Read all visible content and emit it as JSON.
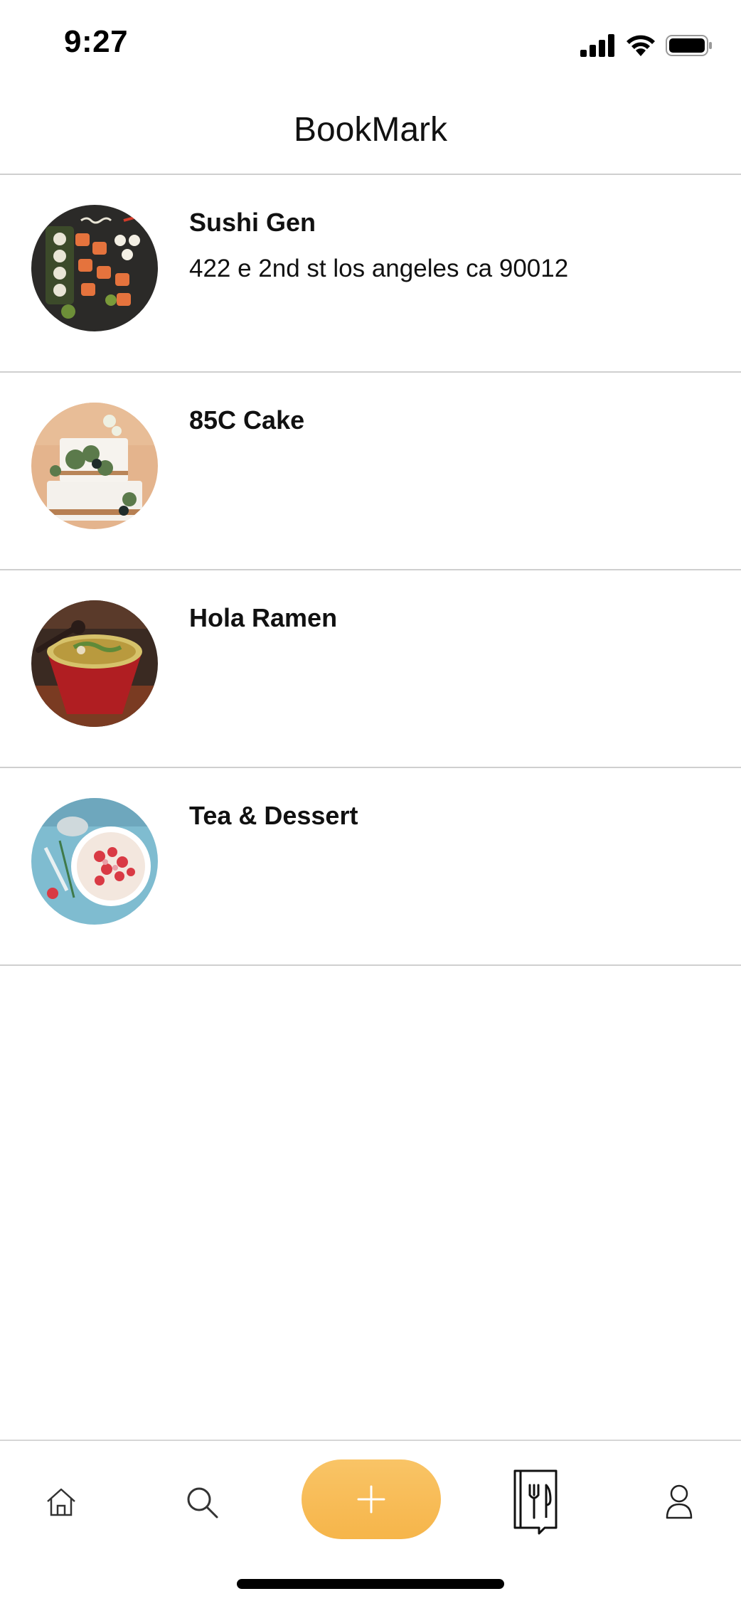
{
  "status_bar": {
    "time": "9:27",
    "icons": [
      "signal-icon",
      "wifi-icon",
      "battery-icon"
    ]
  },
  "header": {
    "title": "BookMark"
  },
  "bookmarks": [
    {
      "name": "Sushi Gen",
      "address": "422 e 2nd st los angeles ca 90012",
      "image": "sushi-photo"
    },
    {
      "name": "85C Cake",
      "address": "",
      "image": "cake-photo"
    },
    {
      "name": "Hola Ramen",
      "address": "",
      "image": "ramen-photo"
    },
    {
      "name": "Tea & Dessert",
      "address": "",
      "image": "dessert-photo"
    }
  ],
  "tab_bar": {
    "items": [
      "home-icon",
      "search-icon",
      "add-icon",
      "menu-book-icon",
      "profile-icon"
    ],
    "accent": "#f8bf5c"
  }
}
